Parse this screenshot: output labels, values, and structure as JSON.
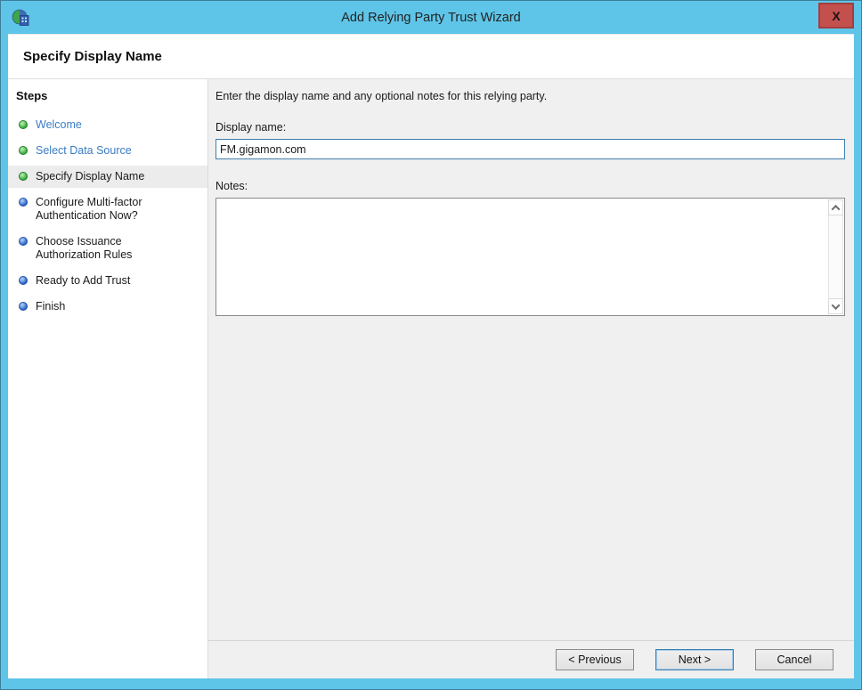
{
  "window": {
    "title": "Add Relying Party Trust Wizard",
    "close_glyph": "X"
  },
  "header": {
    "title": "Specify Display Name"
  },
  "sidebar": {
    "title": "Steps",
    "items": [
      {
        "label": "Welcome",
        "state": "done"
      },
      {
        "label": "Select Data Source",
        "state": "done"
      },
      {
        "label": "Specify Display Name",
        "state": "current"
      },
      {
        "label": "Configure Multi-factor Authentication Now?",
        "state": "todo"
      },
      {
        "label": "Choose Issuance Authorization Rules",
        "state": "todo"
      },
      {
        "label": "Ready to Add Trust",
        "state": "todo"
      },
      {
        "label": "Finish",
        "state": "todo"
      }
    ]
  },
  "content": {
    "intro": "Enter the display name and any optional notes for this relying party.",
    "display_name_label": "Display name:",
    "display_name_value": "FM.gigamon.com",
    "notes_label": "Notes:",
    "notes_value": ""
  },
  "footer": {
    "previous_label": "< Previous",
    "next_label": "Next >",
    "cancel_label": "Cancel"
  },
  "colors": {
    "titlebar_blue": "#5EC5E8",
    "close_red": "#C4504E",
    "link_blue": "#3B7CC4",
    "done_dot_green": "#35AC3C",
    "todo_dot_blue": "#2B62C9",
    "content_bg": "#F0F0F0",
    "input_focus_border": "#3C7FB1"
  }
}
